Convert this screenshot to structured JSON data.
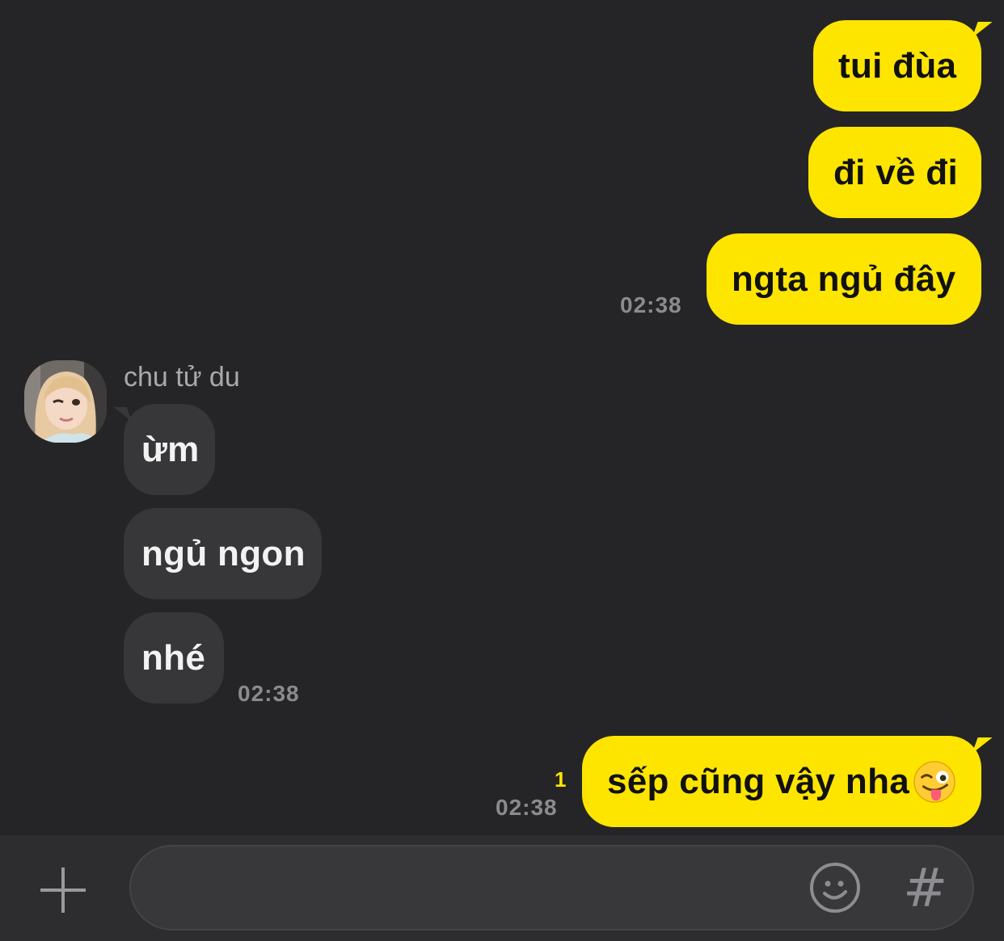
{
  "messages": {
    "m1": "tui đùa",
    "m2": "đi về đi",
    "m3": "ngta ngủ đây",
    "time1": "02:38",
    "sender_name": "chu tử du",
    "r1": "ừm",
    "r2": "ngủ ngon",
    "r3": "nhé",
    "time2": "02:38",
    "m4": "sếp cũng vậy nha",
    "unread": "1",
    "time3": "02:38"
  },
  "input_bar": {
    "plus_icon": "plus-icon",
    "emoji_icon": "smiley-icon",
    "hashtag_label": "#"
  },
  "colors": {
    "my_bubble": "#fee500",
    "their_bubble": "#37373a",
    "background": "#252527"
  }
}
